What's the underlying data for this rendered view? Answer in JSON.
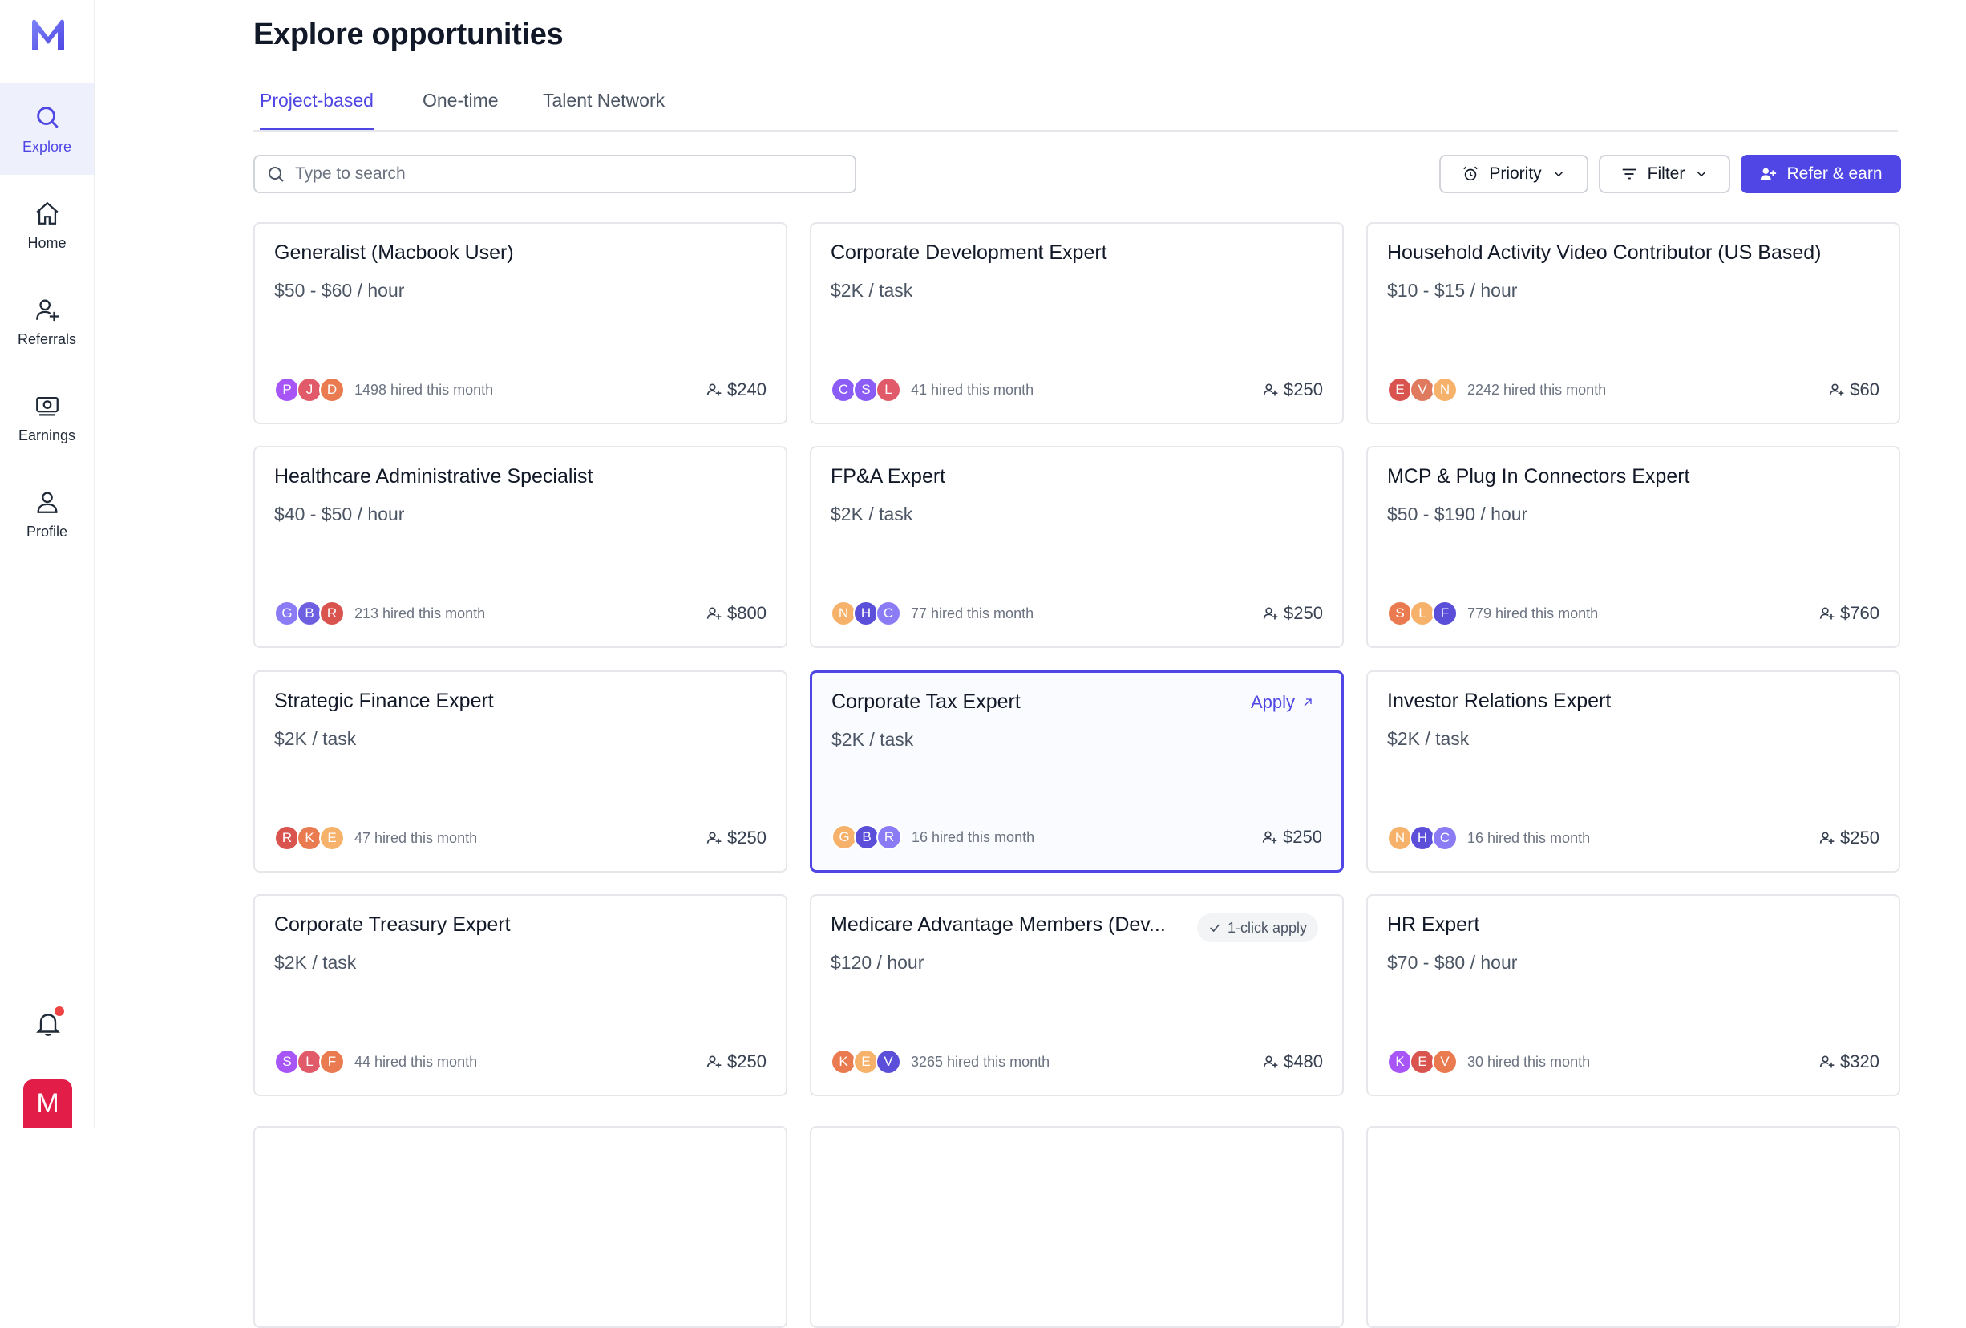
{
  "app": {
    "logo_letter": "M",
    "user_initial": "M",
    "colors": {
      "accent": "#4f46e5",
      "user_avatar": "#e11d48",
      "notification_dot": "#ef4444"
    }
  },
  "sidebar": {
    "items": [
      {
        "label": "Explore",
        "icon": "search-icon",
        "active": true
      },
      {
        "label": "Home",
        "icon": "home-icon",
        "active": false
      },
      {
        "label": "Referrals",
        "icon": "user-plus-icon",
        "active": false
      },
      {
        "label": "Earnings",
        "icon": "cash-icon",
        "active": false
      },
      {
        "label": "Profile",
        "icon": "person-icon",
        "active": false
      }
    ],
    "notifications": {
      "icon": "bell-icon",
      "has_unread": true
    }
  },
  "page": {
    "title": "Explore opportunities"
  },
  "tabs": [
    {
      "label": "Project-based",
      "active": true
    },
    {
      "label": "One-time",
      "active": false
    },
    {
      "label": "Talent Network",
      "active": false
    }
  ],
  "search": {
    "placeholder": "Type to search",
    "value": ""
  },
  "toolbar": {
    "priority_label": "Priority",
    "filter_label": "Filter",
    "refer_label": "Refer & earn"
  },
  "cards": [
    {
      "title": "Generalist (Macbook User)",
      "rate": "$50 - $60 / hour",
      "hired": "1498 hired this month",
      "bonus": "$240",
      "avatars": [
        {
          "l": "P",
          "c": "#a855f7"
        },
        {
          "l": "J",
          "c": "#e05a6a"
        },
        {
          "l": "D",
          "c": "#ea7a4f"
        }
      ]
    },
    {
      "title": "Corporate Development Expert",
      "rate": "$2K / task",
      "hired": "41 hired this month",
      "bonus": "$250",
      "avatars": [
        {
          "l": "C",
          "c": "#8b5cf6"
        },
        {
          "l": "S",
          "c": "#8b5cf6"
        },
        {
          "l": "L",
          "c": "#e05a6a"
        }
      ]
    },
    {
      "title": "Household Activity Video Contributor (US Based)",
      "rate": "$10 - $15 / hour",
      "hired": "2242 hired this month",
      "bonus": "$60",
      "avatars": [
        {
          "l": "E",
          "c": "#d9534f"
        },
        {
          "l": "V",
          "c": "#e07a5f"
        },
        {
          "l": "N",
          "c": "#f6b26b"
        }
      ]
    },
    {
      "title": "Healthcare Administrative Specialist",
      "rate": "$40 - $50 / hour",
      "hired": "213 hired this month",
      "bonus": "$800",
      "avatars": [
        {
          "l": "G",
          "c": "#8b7cf6"
        },
        {
          "l": "B",
          "c": "#6d5fe0"
        },
        {
          "l": "R",
          "c": "#d9534f"
        }
      ]
    },
    {
      "title": "FP&A Expert",
      "rate": "$2K / task",
      "hired": "77 hired this month",
      "bonus": "$250",
      "avatars": [
        {
          "l": "N",
          "c": "#f6b26b"
        },
        {
          "l": "H",
          "c": "#5b4fd9"
        },
        {
          "l": "C",
          "c": "#8b7cf6"
        }
      ]
    },
    {
      "title": "MCP & Plug In Connectors Expert",
      "rate": "$50 - $190 / hour",
      "hired": "779 hired this month",
      "bonus": "$760",
      "avatars": [
        {
          "l": "S",
          "c": "#ea7a4f"
        },
        {
          "l": "L",
          "c": "#f6b26b"
        },
        {
          "l": "F",
          "c": "#5b4fd9"
        }
      ]
    },
    {
      "title": "Strategic Finance Expert",
      "rate": "$2K / task",
      "hired": "47 hired this month",
      "bonus": "$250",
      "avatars": [
        {
          "l": "R",
          "c": "#d9534f"
        },
        {
          "l": "K",
          "c": "#ea7a4f"
        },
        {
          "l": "E",
          "c": "#f6b26b"
        }
      ]
    },
    {
      "title": "Corporate Tax Expert",
      "rate": "$2K / task",
      "hired": "16 hired this month",
      "bonus": "$250",
      "selected": true,
      "apply": "Apply",
      "avatars": [
        {
          "l": "G",
          "c": "#f6b26b"
        },
        {
          "l": "B",
          "c": "#5b4fd9"
        },
        {
          "l": "R",
          "c": "#8b7cf6"
        }
      ]
    },
    {
      "title": "Investor Relations Expert",
      "rate": "$2K / task",
      "hired": "16 hired this month",
      "bonus": "$250",
      "avatars": [
        {
          "l": "N",
          "c": "#f6b26b"
        },
        {
          "l": "H",
          "c": "#5b4fd9"
        },
        {
          "l": "C",
          "c": "#8b7cf6"
        }
      ]
    },
    {
      "title": "Corporate Treasury Expert",
      "rate": "$2K / task",
      "hired": "44 hired this month",
      "bonus": "$250",
      "avatars": [
        {
          "l": "S",
          "c": "#a855f7"
        },
        {
          "l": "L",
          "c": "#e05a6a"
        },
        {
          "l": "F",
          "c": "#ea7a4f"
        }
      ]
    },
    {
      "title": "Medicare Advantage Members (Dev...",
      "rate": "$120 / hour",
      "hired": "3265 hired this month",
      "bonus": "$480",
      "badge": "1-click apply",
      "avatars": [
        {
          "l": "K",
          "c": "#ea7a4f"
        },
        {
          "l": "E",
          "c": "#f6b26b"
        },
        {
          "l": "V",
          "c": "#5b4fd9"
        }
      ]
    },
    {
      "title": "HR Expert",
      "rate": "$70 - $80 / hour",
      "hired": "30 hired this month",
      "bonus": "$320",
      "avatars": [
        {
          "l": "K",
          "c": "#a855f7"
        },
        {
          "l": "E",
          "c": "#d9534f"
        },
        {
          "l": "V",
          "c": "#ea7a4f"
        }
      ]
    }
  ]
}
